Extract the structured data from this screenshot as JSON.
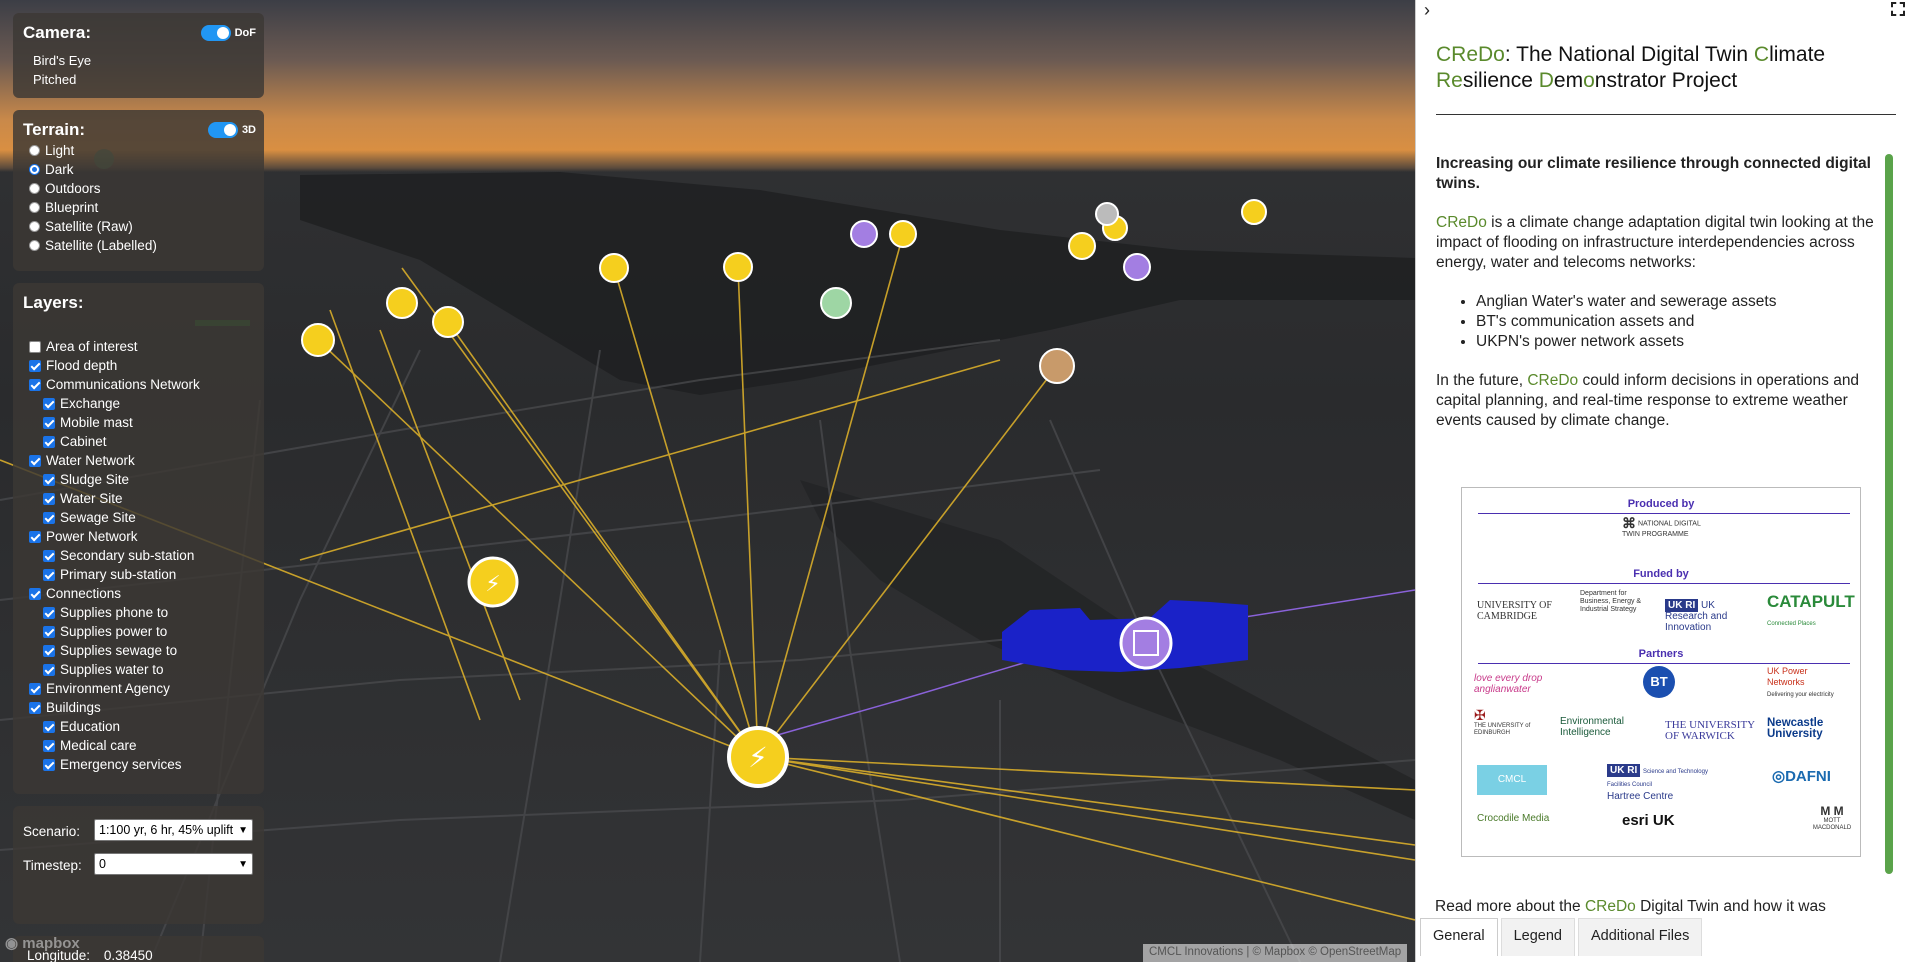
{
  "camera": {
    "title": "Camera:",
    "toggle_label": "DoF",
    "options": [
      "Bird's Eye",
      "Pitched"
    ]
  },
  "terrain": {
    "title": "Terrain:",
    "toggle_label": "3D",
    "options": [
      "Light",
      "Dark",
      "Outdoors",
      "Blueprint",
      "Satellite (Raw)",
      "Satellite (Labelled)"
    ],
    "selected": "Dark"
  },
  "layers": {
    "title": "Layers:",
    "items": [
      {
        "label": "Area of interest",
        "checked": false,
        "indent": 0
      },
      {
        "label": "Flood depth",
        "checked": true,
        "indent": 0
      },
      {
        "label": "Communications Network",
        "checked": true,
        "indent": 0
      },
      {
        "label": "Exchange",
        "checked": true,
        "indent": 1
      },
      {
        "label": "Mobile mast",
        "checked": true,
        "indent": 1
      },
      {
        "label": "Cabinet",
        "checked": true,
        "indent": 1
      },
      {
        "label": "Water Network",
        "checked": true,
        "indent": 0
      },
      {
        "label": "Sludge Site",
        "checked": true,
        "indent": 1
      },
      {
        "label": "Water Site",
        "checked": true,
        "indent": 1
      },
      {
        "label": "Sewage Site",
        "checked": true,
        "indent": 1
      },
      {
        "label": "Power Network",
        "checked": true,
        "indent": 0
      },
      {
        "label": "Secondary sub-station",
        "checked": true,
        "indent": 1
      },
      {
        "label": "Primary sub-station",
        "checked": true,
        "indent": 1
      },
      {
        "label": "Connections",
        "checked": true,
        "indent": 0
      },
      {
        "label": "Supplies phone to",
        "checked": true,
        "indent": 1
      },
      {
        "label": "Supplies power to",
        "checked": true,
        "indent": 1
      },
      {
        "label": "Supplies sewage to",
        "checked": true,
        "indent": 1
      },
      {
        "label": "Supplies water to",
        "checked": true,
        "indent": 1
      },
      {
        "label": "Environment Agency",
        "checked": true,
        "indent": 0
      },
      {
        "label": "Buildings",
        "checked": true,
        "indent": 0
      },
      {
        "label": "Education",
        "checked": true,
        "indent": 1
      },
      {
        "label": "Medical care",
        "checked": true,
        "indent": 1
      },
      {
        "label": "Emergency services",
        "checked": true,
        "indent": 1
      }
    ]
  },
  "controls": {
    "scenario_label": "Scenario:",
    "scenario_value": "1:100 yr, 6 hr, 45% uplift",
    "timestep_label": "Timestep:",
    "timestep_value": "0"
  },
  "coords": {
    "longitude_label": "Longitude:",
    "longitude_value": "0.38450"
  },
  "map": {
    "logo": "mapbox",
    "attribution": "CMCL Innovations | © Mapbox © OpenStreetMap"
  },
  "sidebar": {
    "title_parts": [
      {
        "t": "CReDo",
        "g": true
      },
      {
        "t": ": The National Digital Twin ",
        "g": false
      },
      {
        "t": "C",
        "g": true
      },
      {
        "t": "limate ",
        "g": false
      },
      {
        "t": "Re",
        "g": true
      },
      {
        "t": "silience ",
        "g": false
      },
      {
        "t": "D",
        "g": true
      },
      {
        "t": "em",
        "g": false
      },
      {
        "t": "o",
        "g": true
      },
      {
        "t": "nstrator Project",
        "g": false
      }
    ],
    "lead": "Increasing our climate resilience through connected digital twins.",
    "credo": "CReDo",
    "p1_rest": " is a climate change adaptation digital twin looking at the impact of flooding on infrastructure interdependencies across energy, water and telecoms networks:",
    "bullets": [
      "Anglian Water's water and sewerage assets",
      "BT's communication assets and",
      "UKPN's power network assets"
    ],
    "p2_a": "In the future, ",
    "p2_b": " could inform decisions in operations and capital planning, and real-time response to extreme weather events caused by climate change.",
    "readmore_a": "Read more about the ",
    "readmore_b": " Digital Twin and how it was",
    "logos": {
      "produced_by": "Produced by",
      "funded_by": "Funded by",
      "partners": "Partners",
      "ndtp": "NATIONAL DIGITAL TWIN PROGRAMME",
      "cambridge": "UNIVERSITY OF CAMBRIDGE",
      "beis": "Department for Business, Energy & Industrial Strategy",
      "ukri": "UK Research and Innovation",
      "catapult": "CATAPULT",
      "catapult_sub": "Connected Places",
      "anglian": "love every drop anglianwater",
      "bt": "BT",
      "ukpn": "UK Power Networks",
      "ukpn_sub": "Delivering your electricity",
      "edinburgh": "THE UNIVERSITY of EDINBURGH",
      "jcdei": "Environmental Intelligence",
      "warwick": "THE UNIVERSITY OF WARWICK",
      "newcastle": "Newcastle University",
      "cmcl": "CMCL",
      "hartree": "Hartree Centre",
      "stfc": "Science and Technology Facilities Council",
      "dafni": "DAFNI",
      "crocodile": "Crocodile Media",
      "esri": "esri UK",
      "mott": "MOTT MACDONALD"
    }
  },
  "tabs": [
    "General",
    "Legend",
    "Additional Files"
  ],
  "colors": {
    "accent": "#5a8a2c",
    "toggle": "#2196f3",
    "link_line": "#e3b52a",
    "building": "#1a22c8",
    "partner_heading": "#4a2fb0"
  }
}
